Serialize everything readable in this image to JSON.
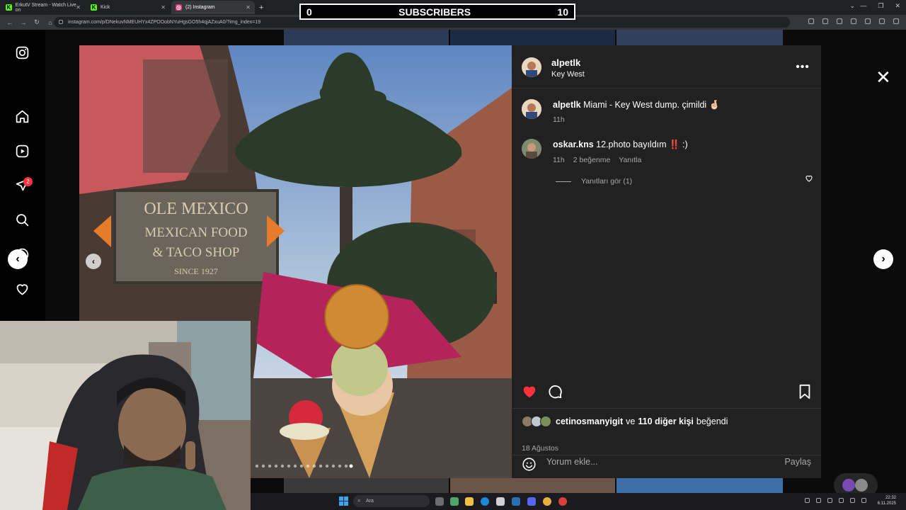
{
  "browser": {
    "tabs": [
      {
        "label": "ErkutV Stream - Watch Live on",
        "fav_color": "#53fc18",
        "fav_glyph": "K"
      },
      {
        "label": "Kick",
        "fav_color": "#53fc18",
        "fav_glyph": "K"
      },
      {
        "label": "(2) Instagram",
        "fav_color": "#e1306c",
        "fav_glyph": "◎"
      }
    ],
    "new_tab": "+",
    "url": "instagram.com/p/DNekuvNMEUHYx4ZPOOobNYuHgsGO5h4qjAZxuA0/?img_index=19"
  },
  "overlay": {
    "left_count": "0",
    "label": "SUBSCRIBERS",
    "right_count": "10"
  },
  "sidebar": {
    "icons": [
      "instagram-logo-icon",
      "home-icon",
      "reels-icon",
      "messages-icon",
      "search-icon",
      "explore-icon",
      "heart-icon"
    ],
    "notification_badge": "2"
  },
  "post": {
    "username": "alpetlk",
    "location": "Key West",
    "more": "•••",
    "caption_user": "alpetlk",
    "caption_text": "Miami - Key West dump. çimildi 🤞🏻",
    "caption_time": "11h",
    "comment": {
      "user": "oskar.kns",
      "text": "12.photo bayıldım ‼️ :)",
      "time": "11h",
      "likes": "2 beğenme",
      "reply": "Yanıtla",
      "view_replies": "Yanıtları gör (1)"
    },
    "liked_by_user": "cetinosmanyigit",
    "liked_by_and": "ve",
    "liked_by_others": "110 diğer kişi",
    "liked_by_suffix": "beğendi",
    "date": "18 Ağustos",
    "add_comment_placeholder": "Yorum ekle...",
    "share_button": "Paylaş",
    "photo_sign_line1": "OLE MEXICO",
    "photo_sign_line2": "MEXICAN FOOD",
    "photo_sign_line3": "& TACO SHOP",
    "photo_sign_line4": "SINCE 1927"
  },
  "taskbar": {
    "search_placeholder": "Ara",
    "time": "22:32",
    "date": "6.11.2025"
  },
  "colors": {
    "like_red": "#ff3040",
    "panel_bg": "#212121",
    "chrome_bg": "#202124"
  }
}
